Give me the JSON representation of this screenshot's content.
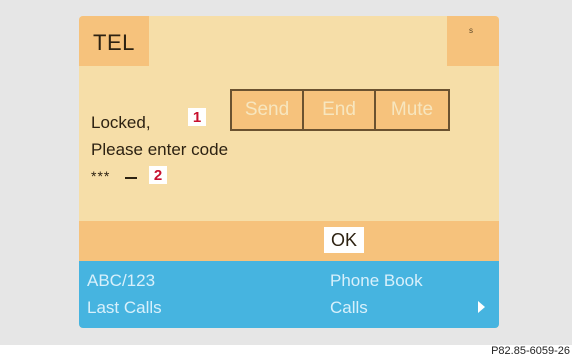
{
  "screen": {
    "title": "TEL",
    "corner_indicator": "s",
    "softkeys": [
      "Send",
      "End",
      "Mute"
    ],
    "message_line1": "Locked,",
    "message_line2": "Please enter code",
    "code_entry": "***",
    "markers": [
      "1",
      "2"
    ],
    "ok_label": "OK",
    "menu": {
      "top_left": "ABC/123",
      "bottom_left": "Last Calls",
      "top_right": "Phone Book",
      "bottom_right": "Calls"
    }
  },
  "figure_code": "P82.85-6059-26",
  "colors": {
    "background": "#e6e6e6",
    "screen": "#f6dea8",
    "tab_orange": "#f6c27c",
    "menu_blue": "#46b4e0",
    "marker_red": "#c8102e"
  },
  "icons": [
    "right-arrow-icon"
  ]
}
